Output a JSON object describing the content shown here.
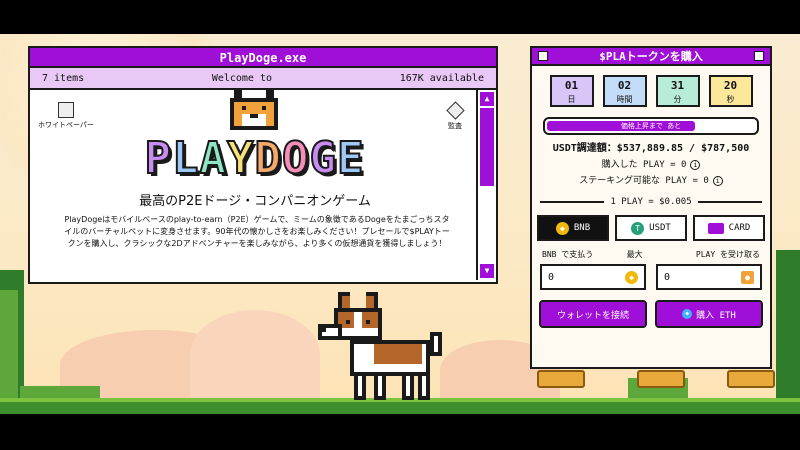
{
  "main_window": {
    "title": "PlayDoge.exe",
    "items_count": "7 items",
    "welcome": "Welcome to",
    "available": "167K available",
    "icon_whitepaper_label": "ホワイトペーパー",
    "icon_audit_label": "監査",
    "logo_text": "PLAYDOGE",
    "tagline": "最高のP2Eドージ・コンパニオンゲーム",
    "description": "PlayDogeはモバイルベースのplay-to-earn（P2E）ゲームで、ミームの象徴であるDogeをたまごっちスタイルのバーチャルペットに変身させます。90年代の懐かしさをお楽しみください！プレセールで$PLAYトークンを購入し、クラシックな2Dアドベンチャーを楽しみながら、より多くの仮想通貨を獲得しましょう！",
    "scroll_up": "▲",
    "scroll_down": "▼"
  },
  "purchase_panel": {
    "title": "$PLAトークンを購入",
    "timer": [
      {
        "value": "01",
        "unit": "日",
        "color": "#d7c6f7"
      },
      {
        "value": "02",
        "unit": "時間",
        "color": "#c3dcf7"
      },
      {
        "value": "31",
        "unit": "分",
        "color": "#b7ecd9"
      },
      {
        "value": "20",
        "unit": "秒",
        "color": "#fbe89a"
      }
    ],
    "progress_text": "価格上昇まで あと",
    "progress_fraction": 0.7,
    "usdt_raised": "USDT調達額：$537,889.85 / $787,500",
    "purchased_play": "購入した PLAY = 0",
    "stakeable_play": "ステーキング可能な PLAY = 0",
    "rate": "1 PLAY = $0.005",
    "currencies": [
      {
        "label": "BNB",
        "icon": "bnb-icon",
        "color": "#f0b90b",
        "active": true
      },
      {
        "label": "USDT",
        "icon": "usdt-icon",
        "color": "#26a17b",
        "active": false
      },
      {
        "label": "CARD",
        "icon": "card-icon",
        "color": "#a00fd8",
        "active": false
      }
    ],
    "pay_label": "BNB で支払う",
    "max_label": "最大",
    "receive_label": "PLAY を受け取る",
    "pay_value": "0",
    "receive_value": "0",
    "connect_wallet": "ウォレットを接続",
    "buy_eth": "購入 ETH",
    "info_mark": "i"
  },
  "colors": {
    "accent": "#a00fd8",
    "title_bar": "#a00fd8",
    "info_bar": "#e9c8f6"
  }
}
